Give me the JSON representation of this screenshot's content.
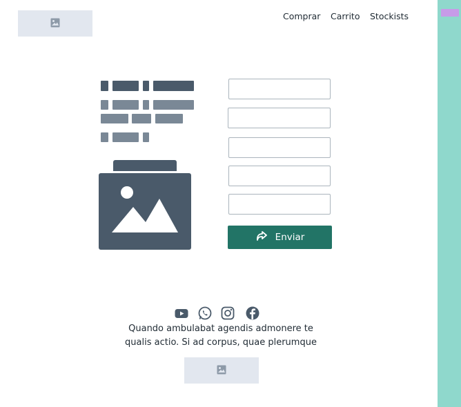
{
  "header": {
    "logo_icon": "image-icon",
    "nav": [
      {
        "label": "Comprar"
      },
      {
        "label": "Carrito"
      },
      {
        "label": "Stockists"
      }
    ]
  },
  "form": {
    "fields": [
      {
        "value": "",
        "placeholder": ""
      },
      {
        "value": "",
        "placeholder": ""
      },
      {
        "value": "",
        "placeholder": ""
      },
      {
        "value": "",
        "placeholder": ""
      },
      {
        "value": "",
        "placeholder": ""
      }
    ],
    "submit_label": "Enviar",
    "submit_icon": "share-arrow-icon"
  },
  "footer": {
    "social_icons": [
      "youtube-icon",
      "whatsapp-icon",
      "instagram-icon",
      "facebook-icon"
    ],
    "text_line1": "Quando ambulabat agendis admonere te",
    "text_line2": "qualis actio. Si ad corpus, quae plerumque",
    "image_icon": "image-icon"
  },
  "colors": {
    "accent": "#227466",
    "side_strip": "#8fd8cc",
    "side_badge": "#c79be8",
    "placeholder_bg": "#e2e7ef",
    "skeleton_dark": "#4a5a6a",
    "skeleton_mid": "#7a8896"
  }
}
